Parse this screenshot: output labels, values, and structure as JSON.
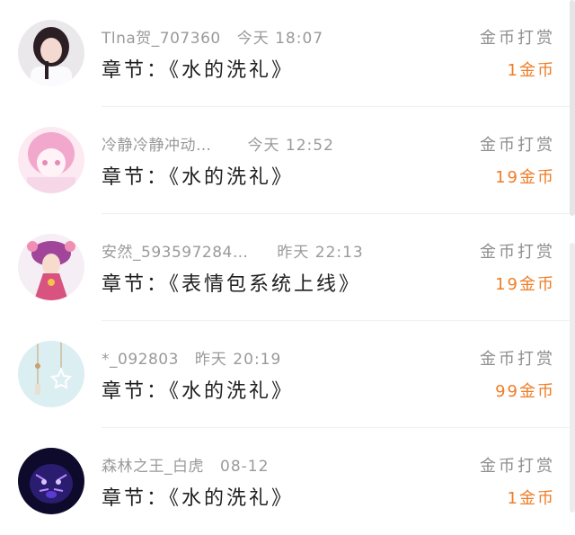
{
  "records": [
    {
      "username": "Tlna贺_707360",
      "time": "今天 18:07",
      "chapter": "章节：《水的洗礼》",
      "action": "金币打赏",
      "amount": "1金币",
      "avatar_icon": "user-avatar-portrait-icon",
      "avatar_colors": [
        "#e9e6ea",
        "#2b1f24",
        "#f3d9cf"
      ]
    },
    {
      "username": "冷静冷静冲动…",
      "time": "今天 12:52",
      "chapter": "章节：《水的洗礼》",
      "action": "金币打赏",
      "amount": "19金币",
      "avatar_icon": "user-avatar-anime-pink-icon",
      "avatar_colors": [
        "#f6d7e8",
        "#f2a8cd",
        "#fce9f2"
      ]
    },
    {
      "username": "安然_593597284…",
      "time": "昨天 22:13",
      "chapter": "章节：《表情包系统上线》",
      "action": "金币打赏",
      "amount": "19金币",
      "avatar_icon": "user-avatar-anime-purple-icon",
      "avatar_colors": [
        "#f5eef4",
        "#a0459a",
        "#f08fb3"
      ]
    },
    {
      "username": "*_092803",
      "time": "昨天 20:19",
      "chapter": "章节：《水的洗礼》",
      "action": "金币打赏",
      "amount": "99金币",
      "avatar_icon": "user-avatar-star-chime-icon",
      "avatar_colors": [
        "#dbeef2",
        "#c9a06a",
        "#ffffff"
      ]
    },
    {
      "username": "森林之王_白虎",
      "time": "08-12",
      "chapter": "章节：《水的洗礼》",
      "action": "金币打赏",
      "amount": "1金币",
      "avatar_icon": "user-avatar-tiger-icon",
      "avatar_colors": [
        "#0d0a2b",
        "#5b3bd8",
        "#b88cff"
      ]
    }
  ],
  "colors": {
    "amount": "#ef7d26",
    "meta": "#9a9a9a",
    "chapter": "#1f1f1f"
  }
}
